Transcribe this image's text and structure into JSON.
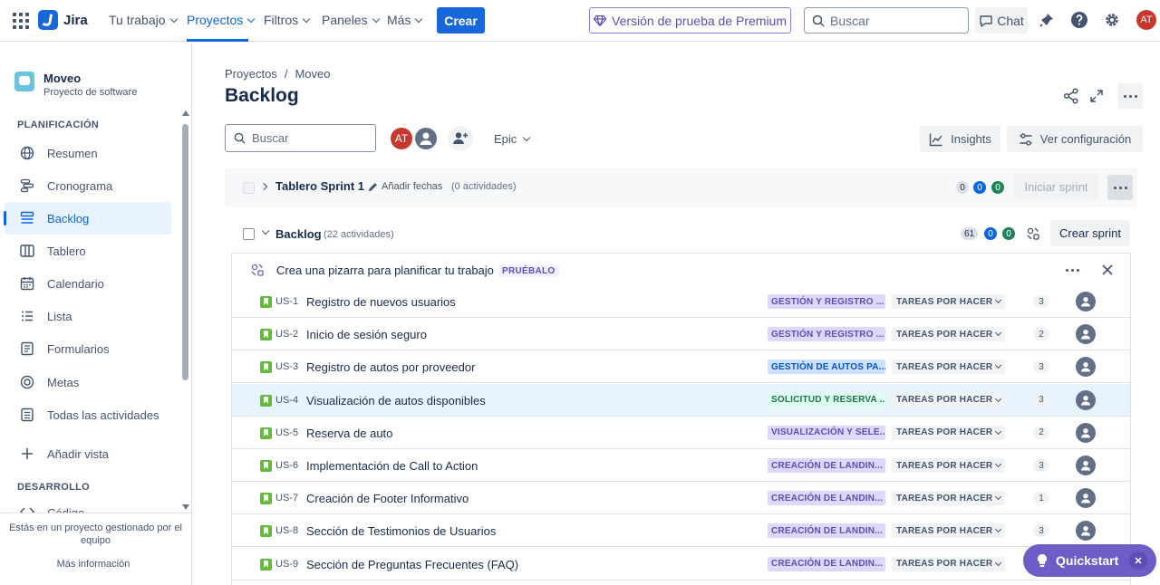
{
  "topnav": {
    "logo": "Jira",
    "items": [
      {
        "label": "Tu trabajo"
      },
      {
        "label": "Proyectos"
      },
      {
        "label": "Filtros"
      },
      {
        "label": "Paneles"
      },
      {
        "label": "Más"
      }
    ],
    "create": "Crear",
    "premium": "Versión de prueba de Premium",
    "search_placeholder": "Buscar",
    "chat": "Chat",
    "avatar": "AT"
  },
  "sidebar": {
    "project_name": "Moveo",
    "project_type": "Proyecto de software",
    "section_planning": "PLANIFICACIÓN",
    "items": [
      {
        "label": "Resumen",
        "icon": "globe-icon"
      },
      {
        "label": "Cronograma",
        "icon": "timeline-icon"
      },
      {
        "label": "Backlog",
        "icon": "backlog-icon"
      },
      {
        "label": "Tablero",
        "icon": "board-icon"
      },
      {
        "label": "Calendario",
        "icon": "calendar-icon"
      },
      {
        "label": "Lista",
        "icon": "list-icon"
      },
      {
        "label": "Formularios",
        "icon": "form-icon"
      },
      {
        "label": "Metas",
        "icon": "target-icon"
      },
      {
        "label": "Todas las actividades",
        "icon": "tasks-icon"
      }
    ],
    "add_view": "Añadir vista",
    "section_dev": "DESARROLLO",
    "dev_partial": "Código",
    "footer_text": "Estás en un proyecto gestionado por el equipo",
    "footer_link": "Más información"
  },
  "main": {
    "breadcrumb": [
      "Proyectos",
      "Moveo"
    ],
    "title": "Backlog",
    "search_placeholder": "Buscar",
    "avatar": "AT",
    "epic_filter": "Epic",
    "insights": "Insights",
    "settings": "Ver configuración"
  },
  "sprint": {
    "name": "Tablero Sprint 1",
    "add_dates": "Añadir fechas",
    "count": "(0 actividades)",
    "pill_gray": "0",
    "pill_blue": "0",
    "pill_green": "0",
    "start": "Iniciar sprint"
  },
  "backlog": {
    "name": "Backlog",
    "count": "(22 actividades)",
    "pill_gray": "61",
    "pill_blue": "0",
    "pill_green": "0",
    "create_sprint": "Crear sprint",
    "promo_text": "Crea una pizarra para planificar tu trabajo",
    "promo_lozenge": "PRUÉBALO",
    "rows": [
      {
        "key": "US-1",
        "summary": "Registro de nuevos usuarios",
        "epic": "GESTIÓN Y REGISTRO ...",
        "epic_color": "#dfd8fd",
        "epic_text": "#5e4db2",
        "status": "TAREAS POR HACER",
        "points": "3"
      },
      {
        "key": "US-2",
        "summary": "Inicio de sesión seguro",
        "epic": "GESTIÓN Y REGISTRO ...",
        "epic_color": "#dfd8fd",
        "epic_text": "#5e4db2",
        "status": "TAREAS POR HACER",
        "points": "2"
      },
      {
        "key": "US-3",
        "summary": "Registro de autos por proveedor",
        "epic": "GESTIÓN DE AUTOS PA...",
        "epic_color": "#cce0ff",
        "epic_text": "#0055cc",
        "status": "TAREAS POR HACER",
        "points": "3"
      },
      {
        "key": "US-4",
        "summary": "Visualización de autos disponibles",
        "epic": "SOLICITUD Y RESERVA ...",
        "epic_color": "#dcfff1",
        "epic_text": "#216e4e",
        "status": "TAREAS POR HACER",
        "points": "3"
      },
      {
        "key": "US-5",
        "summary": "Reserva de auto",
        "epic": "VISUALIZACIÓN Y SELE...",
        "epic_color": "#dfd8fd",
        "epic_text": "#5e4db2",
        "status": "TAREAS POR HACER",
        "points": "2"
      },
      {
        "key": "US-6",
        "summary": "Implementación de Call to Action",
        "epic": "CREACIÓN DE LANDIN...",
        "epic_color": "#dfd8fd",
        "epic_text": "#5e4db2",
        "status": "TAREAS POR HACER",
        "points": "3"
      },
      {
        "key": "US-7",
        "summary": "Creación de Footer Informativo",
        "epic": "CREACIÓN DE LANDIN...",
        "epic_color": "#dfd8fd",
        "epic_text": "#5e4db2",
        "status": "TAREAS POR HACER",
        "points": "1"
      },
      {
        "key": "US-8",
        "summary": "Sección de Testimonios de Usuarios",
        "epic": "CREACIÓN DE LANDIN...",
        "epic_color": "#dfd8fd",
        "epic_text": "#5e4db2",
        "status": "TAREAS POR HACER",
        "points": "3"
      },
      {
        "key": "US-9",
        "summary": "Sección de Preguntas Frecuentes (FAQ)",
        "epic": "CREACIÓN DE LANDIN...",
        "epic_color": "#dfd8fd",
        "epic_text": "#5e4db2",
        "status": "TAREAS POR HACER",
        "points": ""
      }
    ]
  },
  "quickstart": "Quickstart"
}
